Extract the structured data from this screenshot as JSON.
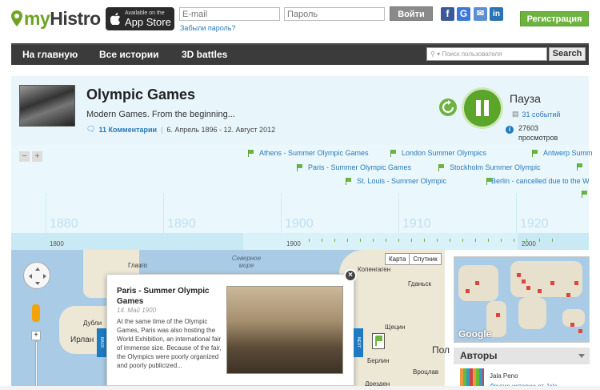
{
  "header": {
    "logo_text_prefix": "my",
    "logo_text_suffix": "Histro",
    "appstore_small": "Available on the",
    "appstore_big": "App Store",
    "email_placeholder": "E-mail",
    "password_placeholder": "Пароль",
    "login_label": "Войти",
    "forgot_label": "Забыли пароль?",
    "social": [
      {
        "name": "facebook-icon",
        "glyph": "f",
        "color": "#3b5998"
      },
      {
        "name": "google-icon",
        "glyph": "G",
        "color": "#3b78d8"
      },
      {
        "name": "mail-icon",
        "glyph": "✉",
        "color": "#5b8fd2"
      },
      {
        "name": "linkedin-icon",
        "glyph": "in",
        "color": "#2a74b3"
      }
    ],
    "register_label": "Регистрация"
  },
  "nav": {
    "items": [
      "На главную",
      "Все истории",
      "3D battles"
    ],
    "search_placeholder": "Поиск пользователя",
    "search_label": "Search"
  },
  "story": {
    "title": "Olympic Games",
    "subtitle": "Modern Games. From the beginning...",
    "comments": "11 Комментарии",
    "date_range": "6. Апрель 1896 - 12. Август 2012",
    "pause_label": "Пауза",
    "events": "31 событий",
    "views_count": "27603",
    "views_label": "просмотров"
  },
  "timeline": {
    "events": [
      "Athens - Summer Olympic Games",
      "London Summer Olympics",
      "Antwerp Summ",
      "Paris - Summer Olympic Games",
      "Stockholm Summer Olympic",
      "St. Louis - Summer Olympic",
      "Berlin - cancelled due to the W"
    ],
    "decades": [
      "1880",
      "1890",
      "1900",
      "1910",
      "1920"
    ],
    "band_labels": [
      "1800",
      "1900",
      "2000"
    ]
  },
  "map": {
    "type_map": "Карта",
    "type_sat": "Спутник",
    "labels": [
      "Глазго",
      "Северное море",
      "Дубли",
      "Ирлан",
      "Копенгаген",
      "Гданьск",
      "Щецин",
      "Берлин",
      "Пол",
      "Вроцлав",
      "Дрезден"
    ],
    "popup": {
      "title": "Paris - Summer Olympic Games",
      "date": "14. Май 1900",
      "text": "At the same time of the Olympic Games, Paris was also hosting the World Exhibition, an international fair of immense size. Because of the fair, the Olympics were poorly organized and poorly publicized...",
      "back_label": "BACK",
      "next_label": "NEXT"
    }
  },
  "sidebar": {
    "google_label": "Google",
    "authors_title": "Авторы",
    "author_name": "Jala Peno",
    "author_link": "Другие истории от Jala"
  }
}
